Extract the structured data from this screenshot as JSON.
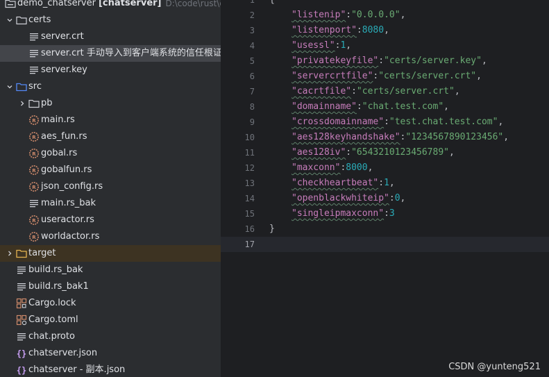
{
  "tree": {
    "root": {
      "name": "demo_chatserver",
      "module": "[chatserver]",
      "path": "D:\\code\\rust\\demo"
    },
    "items": [
      {
        "label": "certs",
        "kind": "folder",
        "expanded": true
      },
      {
        "label": "server.crt",
        "kind": "text"
      },
      {
        "label": "server.crt 手动导入到客户端系统的信任根证书",
        "kind": "text"
      },
      {
        "label": "server.key",
        "kind": "text"
      },
      {
        "label": "src",
        "kind": "src-folder",
        "expanded": true
      },
      {
        "label": "pb",
        "kind": "folder",
        "expanded": false
      },
      {
        "label": "main.rs",
        "kind": "rust"
      },
      {
        "label": "aes_fun.rs",
        "kind": "rust"
      },
      {
        "label": "gobal.rs",
        "kind": "rust"
      },
      {
        "label": "gobalfun.rs",
        "kind": "rust"
      },
      {
        "label": "json_config.rs",
        "kind": "rust"
      },
      {
        "label": "main.rs_bak",
        "kind": "text"
      },
      {
        "label": "useractor.rs",
        "kind": "rust"
      },
      {
        "label": "worldactor.rs",
        "kind": "rust"
      },
      {
        "label": "target",
        "kind": "folder",
        "expanded": false
      },
      {
        "label": "build.rs_bak",
        "kind": "text"
      },
      {
        "label": "build.rs_bak1",
        "kind": "text"
      },
      {
        "label": "Cargo.lock",
        "kind": "cargo"
      },
      {
        "label": "Cargo.toml",
        "kind": "cargo-toml"
      },
      {
        "label": "chat.proto",
        "kind": "text"
      },
      {
        "label": "chatserver.json",
        "kind": "json"
      },
      {
        "label": "chatserver - 副本.json",
        "kind": "json"
      }
    ]
  },
  "editor": {
    "line_numbers": [
      "1",
      "2",
      "3",
      "4",
      "5",
      "6",
      "7",
      "8",
      "9",
      "10",
      "11",
      "12",
      "13",
      "14",
      "15",
      "16",
      "17"
    ],
    "lines": [
      "{",
      "\"listenip\":\"0.0.0.0\",",
      "\"listenport\":8080,",
      "\"usessl\":1,",
      "\"privatekeyfile\":\"certs/server.key\",",
      "\"servercrtfile\":\"certs/server.crt\",",
      "\"cacrtfile\":\"certs/server.crt\",",
      "\"domainname\":\"chat.test.com\",",
      "\"crossdomainname\":\"test.chat.test.com\",",
      "\"aes128keyhandshake\":\"1234567890123456\",",
      "\"aes128iv\":\"6543210123456789\",",
      "\"maxconn\":8000,",
      "\"checkheartbeat\":1,",
      "\"openblackwhiteip\":0,",
      "\"singleipmaxconn\":3",
      "}",
      ""
    ]
  },
  "watermark": "CSDN @yunteng521",
  "colors": {
    "tree_bg": "#2b2d30",
    "editor_bg": "#1e1f22",
    "key": "#c77dbb",
    "string": "#6aab73",
    "number": "#2aacb8",
    "selected_row": "#43454a"
  }
}
